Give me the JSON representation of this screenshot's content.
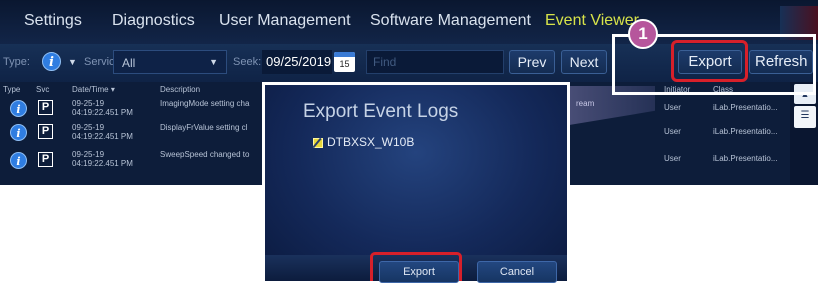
{
  "nav": {
    "items": [
      "Settings",
      "Diagnostics",
      "User Management",
      "Software Management",
      "Event Viewer"
    ],
    "active": "Event Viewer"
  },
  "toolbar": {
    "type_label": "Type:",
    "service_label": "Service:",
    "service_value": "All",
    "seek_label": "Seek:",
    "seek_value": "09/25/2019",
    "calendar_day": "15",
    "find_placeholder": "Find",
    "prev_label": "Prev",
    "next_label": "Next",
    "export_label": "Export",
    "refresh_label": "Refresh"
  },
  "table": {
    "columns": [
      "Type",
      "Svc",
      "Date/Time ▾",
      "Description",
      "Initiator",
      "Class"
    ],
    "rows": [
      {
        "svc": "P",
        "date": "09-25-19",
        "time": "04:19:22.451 PM",
        "description": "ImagingMode setting cha",
        "source": "ream",
        "initiator": "User",
        "class": "iLab.Presentatio..."
      },
      {
        "svc": "P",
        "date": "09-25-19",
        "time": "04:19:22.451 PM",
        "description": "DisplayFrValue setting cl",
        "source": "",
        "initiator": "User",
        "class": "iLab.Presentatio..."
      },
      {
        "svc": "P",
        "date": "09-25-19",
        "time": "04:19:22.451 PM",
        "description": "SweepSpeed changed to",
        "source": "",
        "initiator": "User",
        "class": "iLab.Presentatio..."
      }
    ]
  },
  "dialog": {
    "title": "Export Event Logs",
    "device_label": "DTBXSX_W10B",
    "export_label": "Export",
    "cancel_label": "Cancel"
  },
  "callout": {
    "step_number": "1"
  },
  "colors": {
    "background": "#0d1d3a",
    "active_tab": "#d7e34a",
    "highlight_red": "#d7202a",
    "step_badge": "#b6569c"
  }
}
